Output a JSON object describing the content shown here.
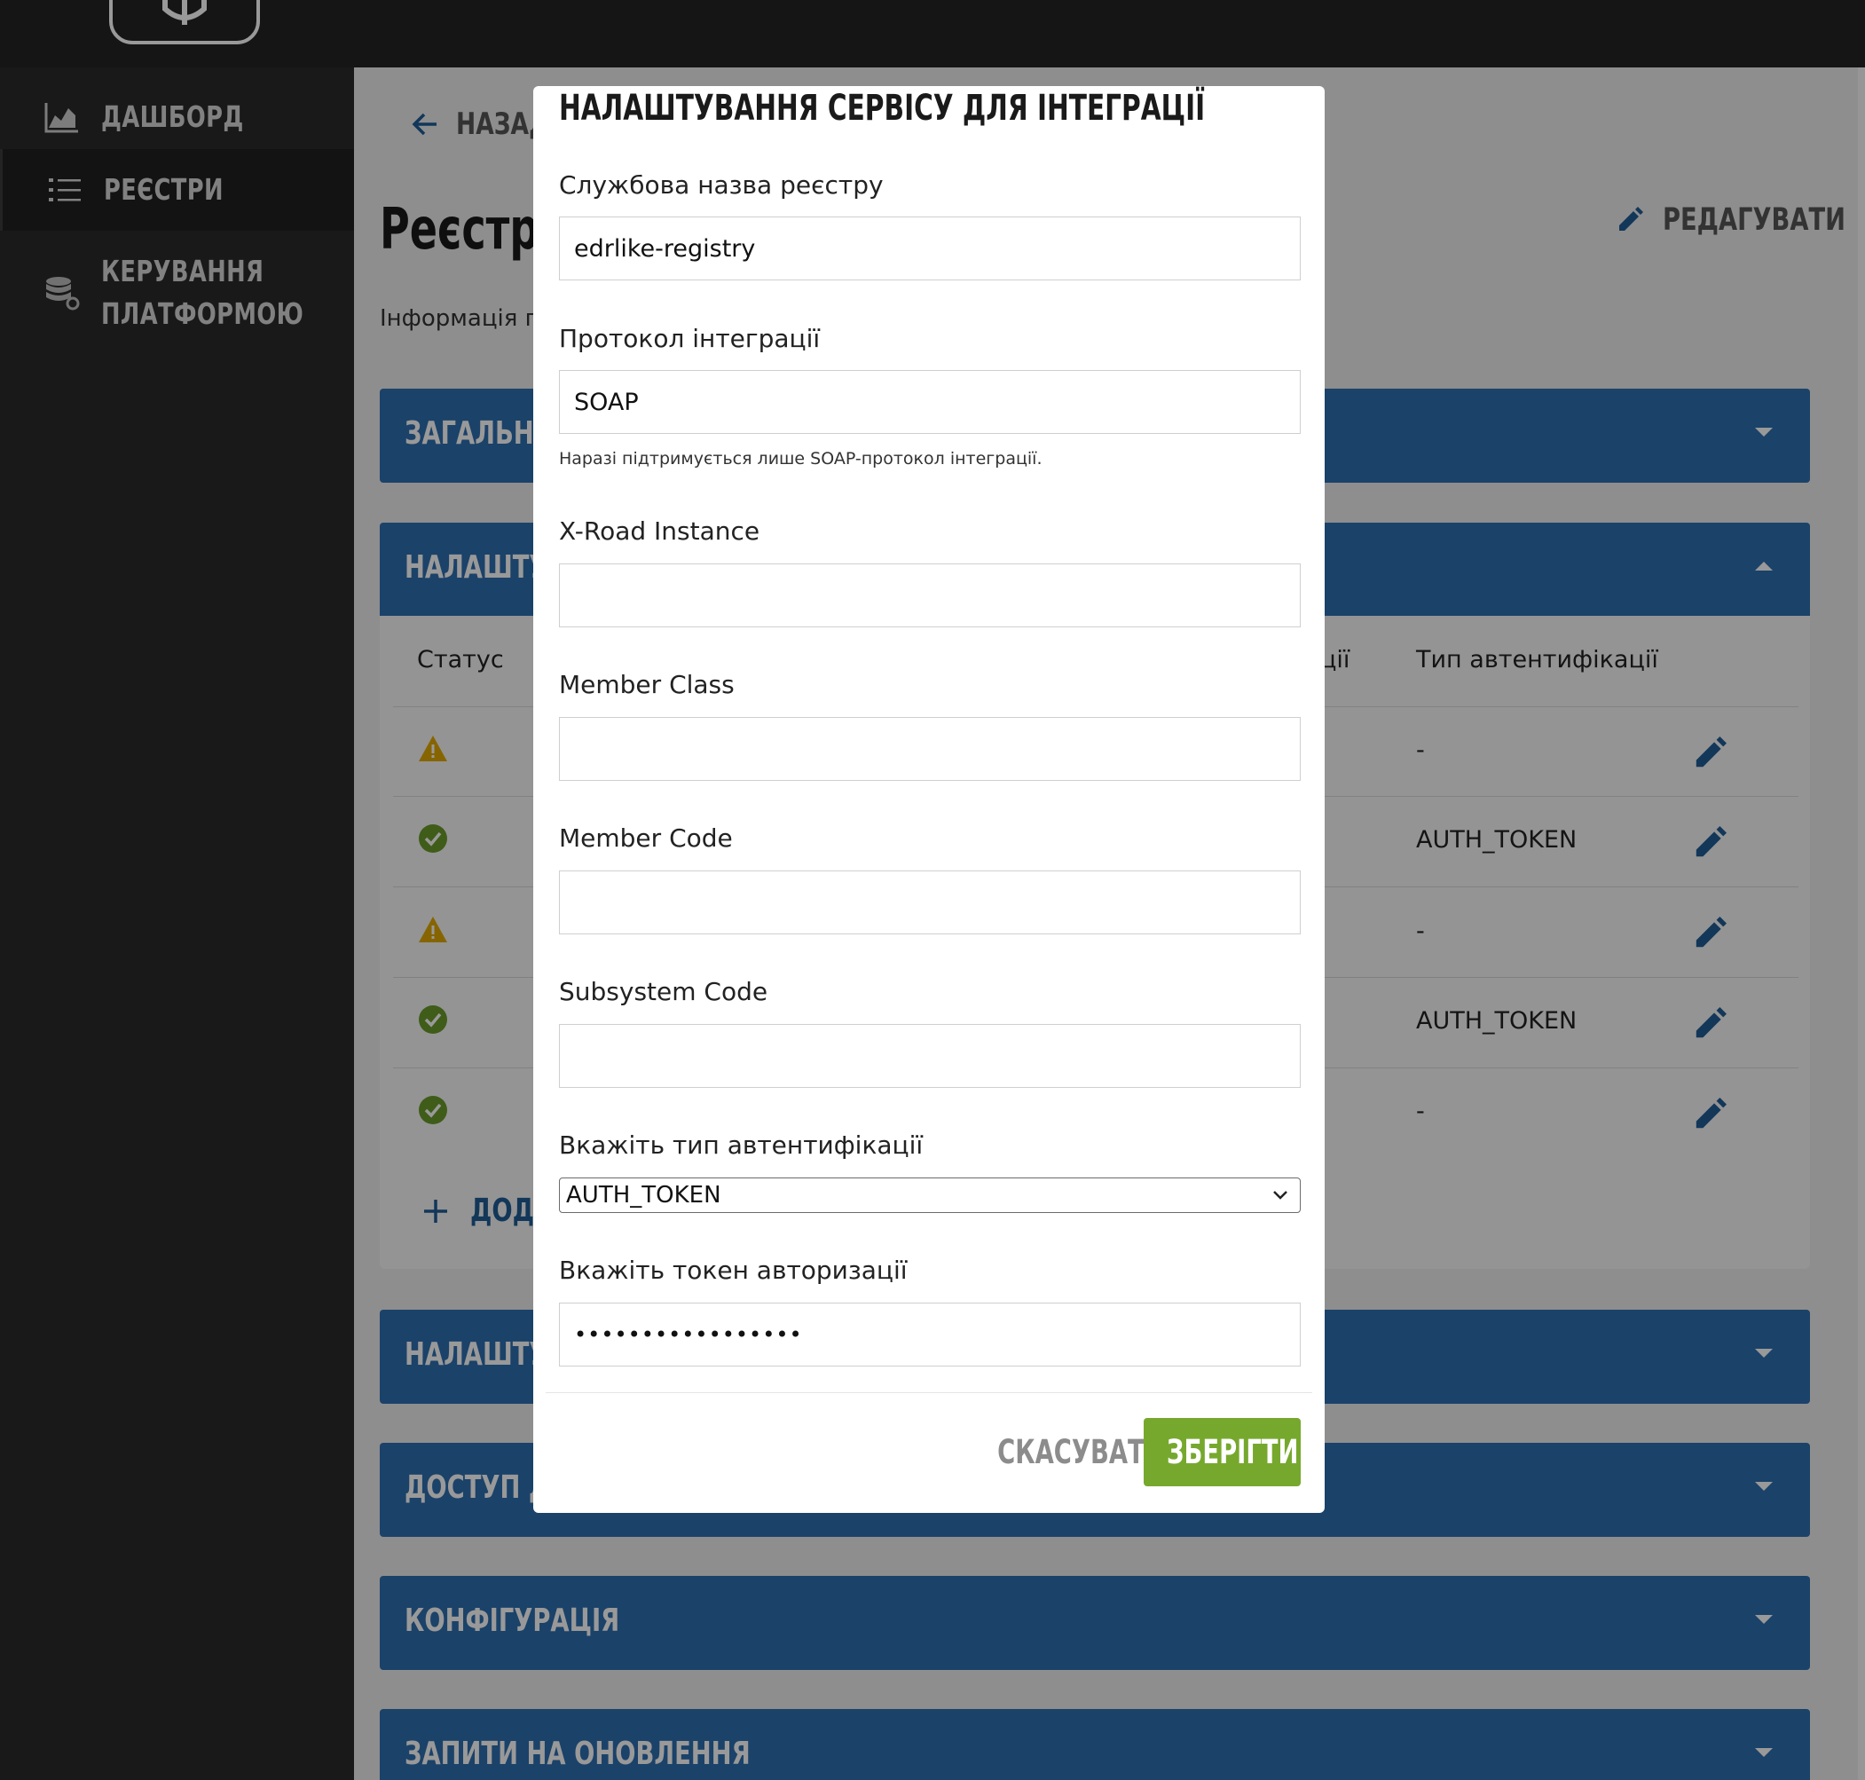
{
  "sidebar": {
    "items": [
      {
        "label": "ДАШБОРД",
        "icon": "chart-area-icon"
      },
      {
        "label": "РЕЄСТРИ",
        "icon": "list-icon",
        "active": true
      },
      {
        "label": "КЕРУВАННЯ",
        "label2": "ПЛАТФОРМОЮ",
        "icon": "database-gear-icon"
      }
    ]
  },
  "page": {
    "back_label": "НАЗАД",
    "title": "Реєстр '",
    "edit_label": "РЕДАГУВАТИ",
    "info": "Інформація пр"
  },
  "sections": [
    {
      "title": "ЗАГАЛЬНА",
      "state": "collapsed"
    },
    {
      "title": "НАЛАШТУВ",
      "state": "expanded"
    },
    {
      "title": "НАЛАШТУВ",
      "state": "collapsed"
    },
    {
      "title": "ДОСТУП ДЈ",
      "state": "collapsed"
    },
    {
      "title": "КОНФІГУРАЦІЯ",
      "state": "collapsed"
    },
    {
      "title": "ЗАПИТИ НА ОНОВЛЕННЯ",
      "state": "collapsed"
    }
  ],
  "table": {
    "headers": {
      "status": "Статус",
      "protocol_fragment": "ції",
      "auth_type": "Тип автентифікації"
    },
    "rows": [
      {
        "status": "warning",
        "auth": "-"
      },
      {
        "status": "ok",
        "auth": "AUTH_TOKEN"
      },
      {
        "status": "warning",
        "auth": "-"
      },
      {
        "status": "ok",
        "auth": "AUTH_TOKEN"
      },
      {
        "status": "ok",
        "auth": "-"
      }
    ],
    "add_label": "ДОДА"
  },
  "modal": {
    "title": "НАЛАШТУВАННЯ СЕРВІСУ ДЛЯ ІНТЕГРАЦІЇ",
    "fields": {
      "registry_name": {
        "label": "Службова назва реєстру",
        "value": "edrlike-registry"
      },
      "protocol": {
        "label": "Протокол інтеграції",
        "value": "SOAP",
        "help": "Наразі підтримується лише SOAP-протокол інтеграції."
      },
      "xroad_instance": {
        "label": "X-Road Instance",
        "value": ""
      },
      "member_class": {
        "label": "Member Class",
        "value": ""
      },
      "member_code": {
        "label": "Member Code",
        "value": ""
      },
      "subsystem_code": {
        "label": "Subsystem Code",
        "value": ""
      },
      "auth_type": {
        "label": "Вкажіть тип автентифікації",
        "value": "AUTH_TOKEN"
      },
      "auth_token": {
        "label": "Вкажіть токен авторизації",
        "value": "•••••••••••••••••"
      }
    },
    "cancel_label": "СКАСУВАТИ",
    "save_label": "ЗБЕРІГТИ"
  },
  "colors": {
    "primary_blue": "#2d6fb0",
    "save_green": "#77a82e",
    "warning": "#e0a800",
    "ok": "#6a9a2b"
  }
}
